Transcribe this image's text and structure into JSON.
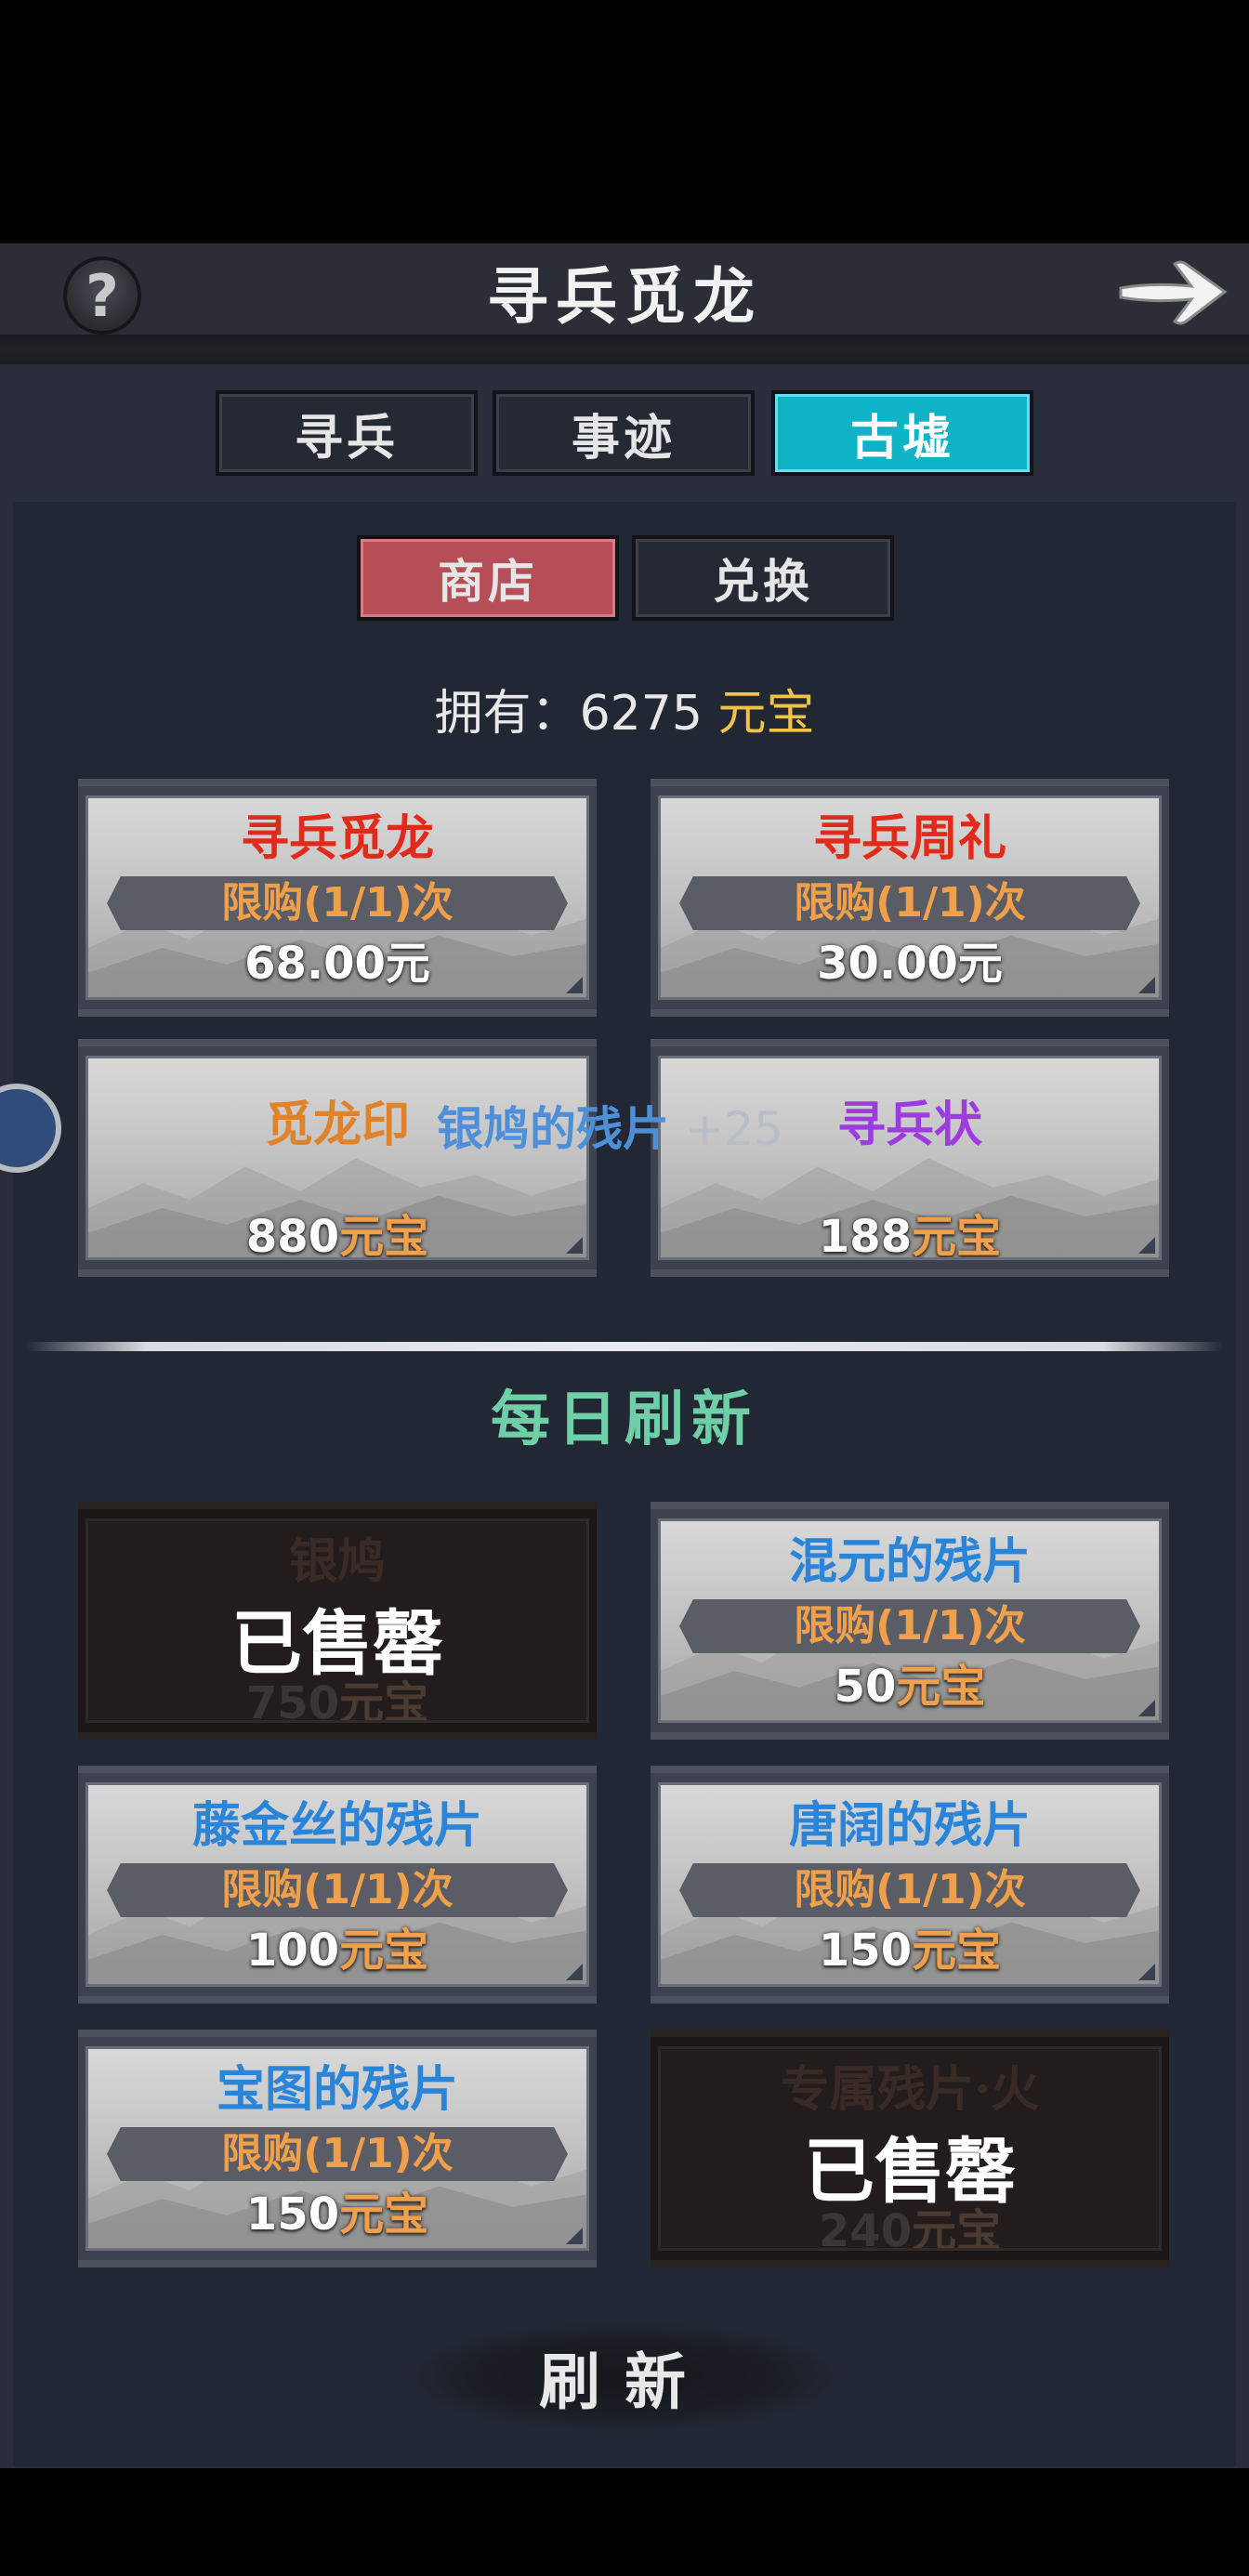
{
  "header": {
    "title": "寻兵觅龙",
    "help_symbol": "?"
  },
  "tabs": [
    {
      "label": "寻兵",
      "active": false
    },
    {
      "label": "事迹",
      "active": false
    },
    {
      "label": "古墟",
      "active": true
    }
  ],
  "subtabs": [
    {
      "label": "商店",
      "active": true
    },
    {
      "label": "兑换",
      "active": false
    }
  ],
  "balance": {
    "prefix": "拥有：",
    "amount": "6275",
    "currency": "元宝"
  },
  "shop_items": [
    {
      "name": "寻兵觅龙",
      "name_color": "#e02a1a",
      "limit": "限购(1/1)次",
      "price": "68.00",
      "price_unit": "元",
      "sold_out": false
    },
    {
      "name": "寻兵周礼",
      "name_color": "#e02a1a",
      "limit": "限购(1/1)次",
      "price": "30.00",
      "price_unit": "元",
      "sold_out": false
    },
    {
      "name": "觅龙印",
      "name_color": "#e0822a",
      "limit": "",
      "price": "880",
      "price_unit": "元宝",
      "sold_out": false
    },
    {
      "name": "寻兵状",
      "name_color": "#9b3be0",
      "limit": "",
      "price": "188",
      "price_unit": "元宝",
      "sold_out": false
    }
  ],
  "floating_reward": {
    "text": "银鸠的残片",
    "amount": "+25"
  },
  "daily": {
    "title": "每日刷新",
    "sold_label": "已售罄",
    "items": [
      {
        "name": "银鸠",
        "name_color": "#3a2a26",
        "limit": "",
        "price": "750",
        "price_unit": "元宝",
        "sold_out": true
      },
      {
        "name": "混元的残片",
        "name_color": "#2a84d8",
        "limit": "限购(1/1)次",
        "price": "50",
        "price_unit": "元宝",
        "sold_out": false
      },
      {
        "name": "藤金丝的残片",
        "name_color": "#2a84d8",
        "limit": "限购(1/1)次",
        "price": "100",
        "price_unit": "元宝",
        "sold_out": false
      },
      {
        "name": "唐阔的残片",
        "name_color": "#2a84d8",
        "limit": "限购(1/1)次",
        "price": "150",
        "price_unit": "元宝",
        "sold_out": false
      },
      {
        "name": "宝图的残片",
        "name_color": "#2a84d8",
        "limit": "限购(1/1)次",
        "price": "150",
        "price_unit": "元宝",
        "sold_out": false
      },
      {
        "name": "专属残片·火",
        "name_color": "#3a2246",
        "limit": "",
        "price": "240",
        "price_unit": "元宝",
        "sold_out": true
      }
    ]
  },
  "refresh_button": {
    "label": "刷新"
  }
}
